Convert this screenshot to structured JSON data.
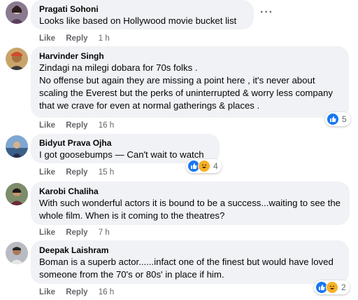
{
  "comments": [
    {
      "author": "Pragati Sohoni",
      "text": "Looks like based on Hollywood movie bucket list",
      "like_label": "Like",
      "reply_label": "Reply",
      "time": "1 h"
    },
    {
      "author": "Harvinder Singh",
      "text": "Zindagi na milegi dobara for 70s folks .\nNo offense but again they are missing a point here , it's never about scaling the Everest but the perks of uninterrupted & worry less company that we crave for even at normal gatherings & places .",
      "like_label": "Like",
      "reply_label": "Reply",
      "time": "16 h",
      "reaction_count": "5"
    },
    {
      "author": "Bidyut Prava Ojha",
      "text": "I got goosebumps — Can't wait to watch",
      "like_label": "Like",
      "reply_label": "Reply",
      "time": "15 h",
      "reaction_count": "4"
    },
    {
      "author": "Karobi Chaliha",
      "text": "With such wonderful actors it is bound to be a success...waiting to see the whole film. When is it coming to the theatres?",
      "like_label": "Like",
      "reply_label": "Reply",
      "time": "7 h"
    },
    {
      "author": "Deepak Laishram",
      "text": "Boman is a superb actor......infact one of the finest but would have loved someone from the 70's or 80s' in place if him.",
      "like_label": "Like",
      "reply_label": "Reply",
      "time": "16 h",
      "reaction_count": "2"
    }
  ],
  "more_options_label": "···",
  "colors": {
    "bubble": "#f0f2f5",
    "secondary_text": "#65676b",
    "like_blue": "#1877f2",
    "haha_yellow": "#f7b125"
  },
  "icons": [
    "avatar",
    "more-options-icon",
    "like-reaction-icon",
    "haha-reaction-icon"
  ]
}
